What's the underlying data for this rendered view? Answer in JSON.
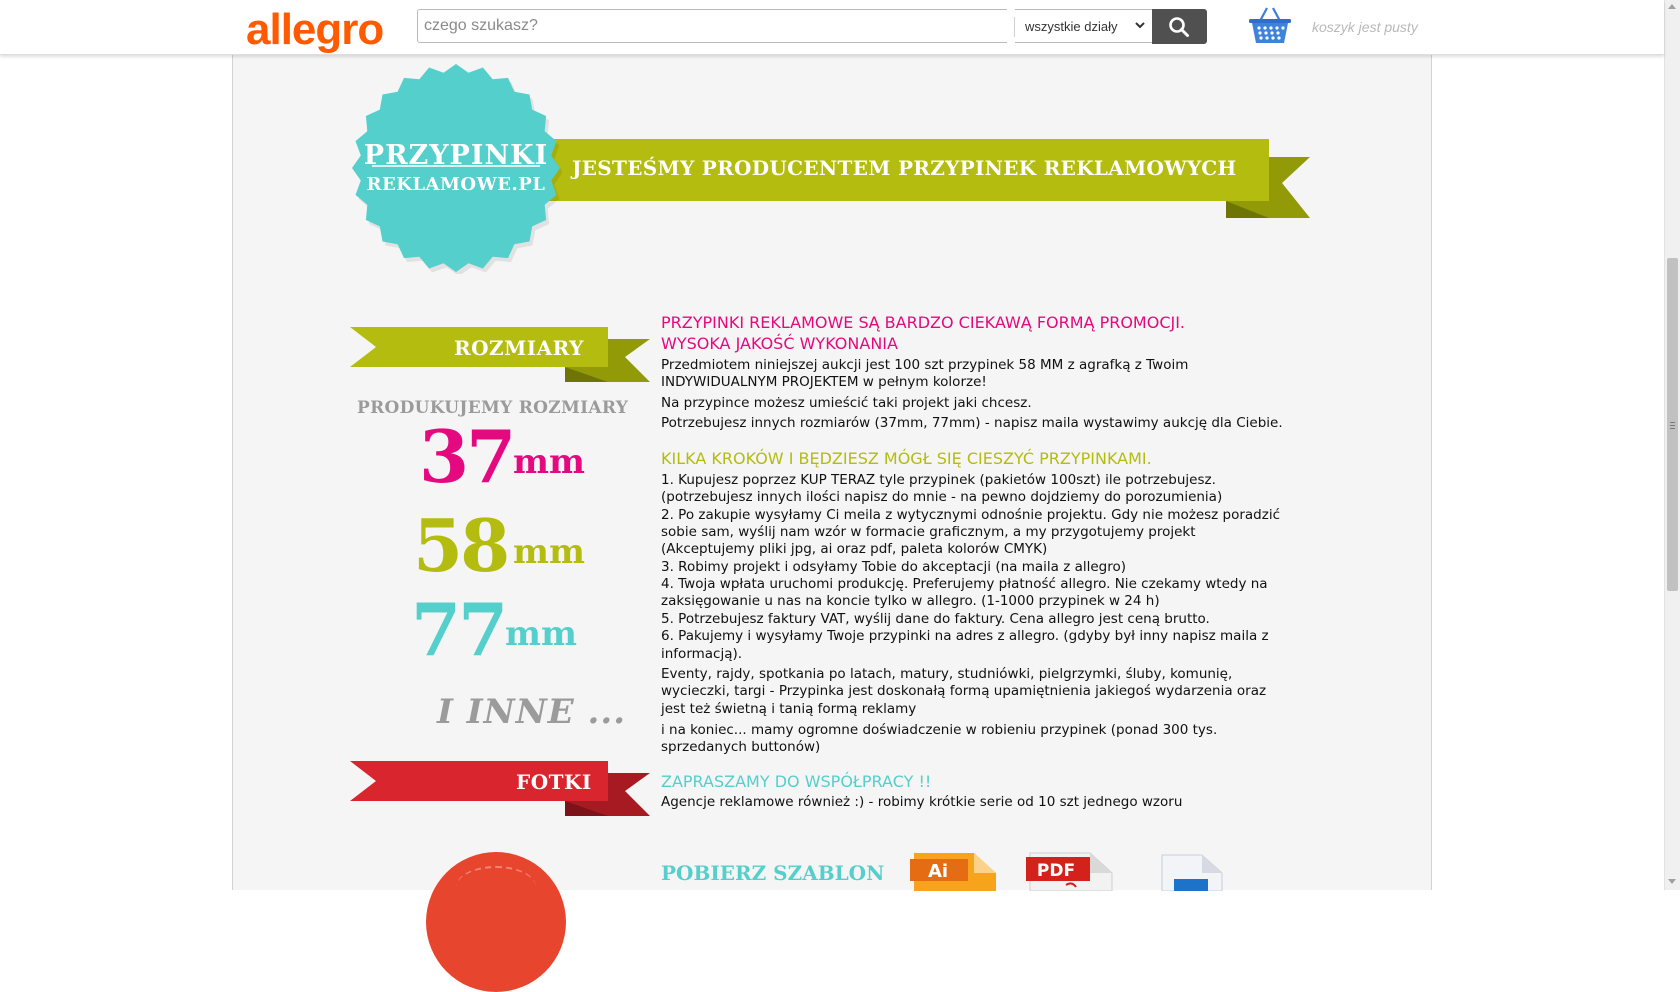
{
  "header": {
    "logo": "allegro",
    "search_placeholder": "czego szukasz?",
    "category": "wszystkie działy",
    "basket_text": "koszyk jest pusty"
  },
  "banner": {
    "seal_line1": "PRZYPINKI",
    "seal_line2": "REKLAMOWE.PL",
    "ribbon_text": "JESTEŚMY PRODUCENTEM PRZYPINEK REKLAMOWYCH"
  },
  "sizes": {
    "ribbon_label": "ROZMIARY",
    "title": "PRODUKUJEMY ROZMIARY",
    "items": [
      {
        "value": "37",
        "unit": "mm",
        "color": "#e5097f"
      },
      {
        "value": "58",
        "unit": "mm",
        "color": "#b3bc0f"
      },
      {
        "value": "77",
        "unit": "mm",
        "color": "#55cfcb"
      }
    ],
    "more": "I INNE ..."
  },
  "photos": {
    "ribbon_label": "FOTKI"
  },
  "content": {
    "heading1_line1": "PRZYPINKI REKLAMOWE SĄ BARDZO CIEKAWĄ FORMĄ PROMOCJI.",
    "heading1_line2": "WYSOKA JAKOŚĆ WYKONANIA",
    "intro": [
      "Przedmiotem niniejszej aukcji jest 100 szt przypinek 58 MM z agrafką z Twoim",
      "INDYWIDUALNYM PROJEKTEM w pełnym kolorze!",
      "Na przypince możesz umieścić taki projekt jaki chcesz.",
      "Potrzebujesz innych rozmiarów (37mm, 77mm) - napisz maila wystawimy aukcję dla Ciebie."
    ],
    "heading2": "KILKA KROKÓW I BĘDZIESZ MÓGŁ SIĘ CIESZYĆ PRZYPINKAMI.",
    "steps": [
      "1. Kupujesz poprzez KUP TERAZ tyle przypinek (pakietów 100szt) ile potrzebujesz.",
      "(potrzebujesz innych ilości napisz do mnie - na pewno dojdziemy do porozumienia)",
      "2. Po zakupie wysyłamy Ci meila z wytycznymi odnośnie projektu. Gdy nie możesz poradzić",
      "sobie sam, wyślij nam wzór w formacie graficznym, a my przygotujemy projekt",
      "(Akceptujemy pliki jpg, ai oraz pdf, paleta kolorów CMYK)",
      "3. Robimy projekt i odsyłamy Tobie do akceptacji (na maila z allegro)",
      "4. Twoja wpłata uruchomi produkcję. Preferujemy płatność allegro. Nie czekamy wtedy na",
      "zaksięgowanie u nas na koncie tylko w allegro. (1-1000 przypinek w 24 h)",
      "5. Potrzebujesz faktury VAT, wyślij dane do faktury. Cena allegro jest ceną brutto.",
      "6. Pakujemy i wysyłamy Twoje przypinki na adres z allegro. (gdyby był inny napisz maila z",
      "informacją)."
    ],
    "events": [
      "Eventy, rajdy, spotkania po latach, matury, studniówki, pielgrzymki, śluby, komunię,",
      "wycieczki, targi - Przypinka jest doskonałą formą upamiętnienia jakiegoś wydarzenia oraz",
      "jest też świetną i tanią formą reklamy"
    ],
    "experience": [
      "i na koniec... mamy ogromne doświadczenie w robieniu przypinek (ponad 300 tys.",
      "sprzedanych buttonów)"
    ],
    "heading3": "ZAPRASZAMY DO WSPÓŁPRACY !!",
    "agencies": "Agencje reklamowe również :) - robimy krótkie serie od 10 szt jednego wzoru",
    "download_title": "POBIERZ SZABLON",
    "file_ai": "Ai",
    "file_pdf": "PDF"
  },
  "colors": {
    "magenta": "#e5097f",
    "olive": "#b3bc0f",
    "teal": "#55cfcb",
    "red": "#d9252e",
    "brand": "#ff5a00"
  }
}
